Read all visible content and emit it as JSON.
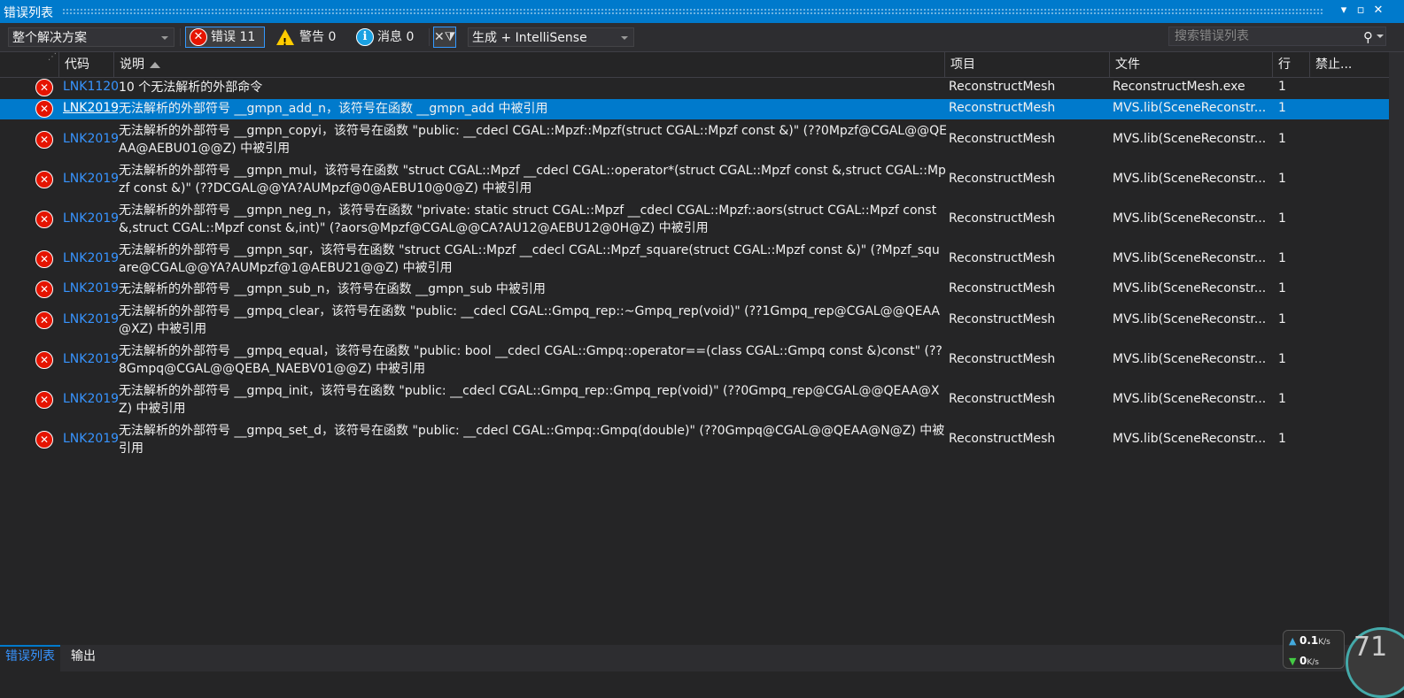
{
  "window": {
    "title": "错误列表"
  },
  "toolbar": {
    "scope": "整个解决方案",
    "errors_label": "错误 11",
    "warnings_label": "警告 0",
    "messages_label": "消息 0",
    "build_filter": "生成 + IntelliSense",
    "search_placeholder": "搜索错误列表"
  },
  "columns": {
    "code": "代码",
    "description": "说明",
    "project": "项目",
    "file": "文件",
    "line": "行",
    "suppress": "禁止..."
  },
  "rows": [
    {
      "code": "LNK1120",
      "description": "10 个无法解析的外部命令",
      "project": "ReconstructMesh",
      "file": "ReconstructMesh.exe",
      "line": "1"
    },
    {
      "code": "LNK2019",
      "description": "无法解析的外部符号 __gmpn_add_n，该符号在函数 __gmpn_add 中被引用",
      "project": "ReconstructMesh",
      "file": "MVS.lib(SceneReconstr...",
      "line": "1"
    },
    {
      "code": "LNK2019",
      "description": "无法解析的外部符号 __gmpn_copyi，该符号在函数 \"public: __cdecl CGAL::Mpzf::Mpzf(struct CGAL::Mpzf const &)\" (??0Mpzf@CGAL@@QEAA@AEBU01@@Z) 中被引用",
      "project": "ReconstructMesh",
      "file": "MVS.lib(SceneReconstr...",
      "line": "1"
    },
    {
      "code": "LNK2019",
      "description": "无法解析的外部符号 __gmpn_mul，该符号在函数 \"struct CGAL::Mpzf __cdecl CGAL::operator*(struct CGAL::Mpzf const &,struct CGAL::Mpzf const &)\" (??DCGAL@@YA?AUMpzf@0@AEBU10@0@Z) 中被引用",
      "project": "ReconstructMesh",
      "file": "MVS.lib(SceneReconstr...",
      "line": "1"
    },
    {
      "code": "LNK2019",
      "description": "无法解析的外部符号 __gmpn_neg_n，该符号在函数 \"private: static struct CGAL::Mpzf __cdecl CGAL::Mpzf::aors(struct CGAL::Mpzf const &,struct CGAL::Mpzf const &,int)\" (?aors@Mpzf@CGAL@@CA?AU12@AEBU12@0H@Z) 中被引用",
      "project": "ReconstructMesh",
      "file": "MVS.lib(SceneReconstr...",
      "line": "1"
    },
    {
      "code": "LNK2019",
      "description": "无法解析的外部符号 __gmpn_sqr，该符号在函数 \"struct CGAL::Mpzf __cdecl CGAL::Mpzf_square(struct CGAL::Mpzf const &)\" (?Mpzf_square@CGAL@@YA?AUMpzf@1@AEBU21@@Z) 中被引用",
      "project": "ReconstructMesh",
      "file": "MVS.lib(SceneReconstr...",
      "line": "1"
    },
    {
      "code": "LNK2019",
      "description": "无法解析的外部符号 __gmpn_sub_n，该符号在函数 __gmpn_sub 中被引用",
      "project": "ReconstructMesh",
      "file": "MVS.lib(SceneReconstr...",
      "line": "1"
    },
    {
      "code": "LNK2019",
      "description": "无法解析的外部符号 __gmpq_clear，该符号在函数 \"public: __cdecl CGAL::Gmpq_rep::~Gmpq_rep(void)\" (??1Gmpq_rep@CGAL@@QEAA@XZ) 中被引用",
      "project": "ReconstructMesh",
      "file": "MVS.lib(SceneReconstr...",
      "line": "1"
    },
    {
      "code": "LNK2019",
      "description": "无法解析的外部符号 __gmpq_equal，该符号在函数 \"public: bool __cdecl CGAL::Gmpq::operator==(class CGAL::Gmpq const &)const\" (??8Gmpq@CGAL@@QEBA_NAEBV01@@Z) 中被引用",
      "project": "ReconstructMesh",
      "file": "MVS.lib(SceneReconstr...",
      "line": "1"
    },
    {
      "code": "LNK2019",
      "description": "无法解析的外部符号 __gmpq_init，该符号在函数 \"public: __cdecl CGAL::Gmpq_rep::Gmpq_rep(void)\" (??0Gmpq_rep@CGAL@@QEAA@XZ) 中被引用",
      "project": "ReconstructMesh",
      "file": "MVS.lib(SceneReconstr...",
      "line": "1"
    },
    {
      "code": "LNK2019",
      "description": "无法解析的外部符号 __gmpq_set_d，该符号在函数 \"public: __cdecl CGAL::Gmpq::Gmpq(double)\" (??0Gmpq@CGAL@@QEAA@N@Z) 中被引用",
      "project": "ReconstructMesh",
      "file": "MVS.lib(SceneReconstr...",
      "line": "1"
    }
  ],
  "selected_row": 1,
  "bottom_tabs": {
    "errors": "错误列表",
    "output": "输出"
  },
  "net_widget": {
    "up": "0.1",
    "down": "0",
    "unit": "K/s",
    "gauge": "71"
  },
  "icons": [
    "error-icon",
    "warning-icon",
    "info-icon",
    "filter-icon",
    "search-icon",
    "pin-icon",
    "close-icon"
  ],
  "colors": {
    "accent": "#007acc",
    "error": "#e51400",
    "link": "#3794ff",
    "warning": "#ffcc00"
  }
}
